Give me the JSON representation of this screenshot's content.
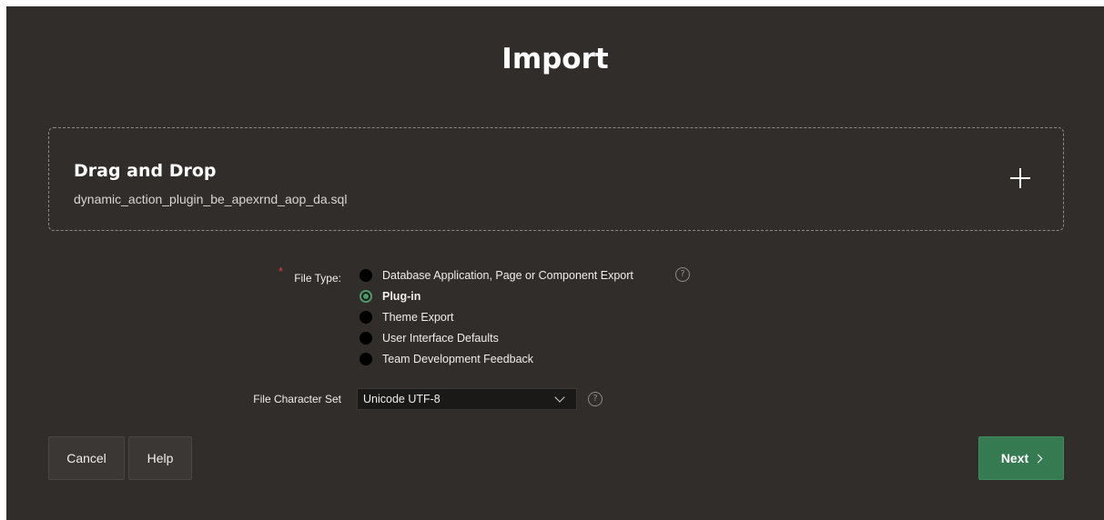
{
  "dialog": {
    "title": "Import"
  },
  "dropzone": {
    "heading": "Drag and Drop",
    "file_name": "dynamic_action_plugin_be_apexrnd_aop_da.sql",
    "add_icon": "plus-icon"
  },
  "file_type": {
    "label": "File Type:",
    "required_marker": "*",
    "selected": "Plug-in",
    "options": [
      {
        "label": "Database Application, Page or Component Export",
        "checked": false
      },
      {
        "label": "Plug-in",
        "checked": true
      },
      {
        "label": "Theme Export",
        "checked": false
      },
      {
        "label": "User Interface Defaults",
        "checked": false
      },
      {
        "label": "Team Development Feedback",
        "checked": false
      }
    ],
    "help_icon": "question-circle-icon",
    "help_glyph": "?"
  },
  "charset": {
    "label": "File Character Set",
    "value": "Unicode UTF-8",
    "help_glyph": "?"
  },
  "buttons": {
    "cancel": "Cancel",
    "help": "Help",
    "next": "Next"
  },
  "colors": {
    "background": "#312d2a",
    "accent_green": "#367a52",
    "required_red": "#e0423c"
  }
}
